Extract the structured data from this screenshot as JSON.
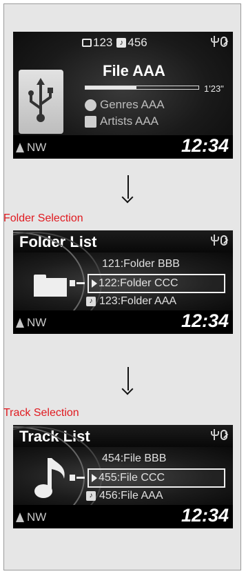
{
  "screen1": {
    "folder_count": "123",
    "track_count": "456",
    "file_title": "File AAA",
    "elapsed": "1'23\"",
    "progress": 0.45,
    "genre": "Genres AAA",
    "artist": "Artists AAA",
    "heading": "NW",
    "clock": "12:34"
  },
  "folder_section": {
    "label": "Folder Selection",
    "title": "Folder List",
    "items": [
      "121:Folder BBB",
      "122:Folder CCC",
      "123:Folder AAA"
    ],
    "heading": "NW",
    "clock": "12:34"
  },
  "track_section": {
    "label": "Track Selection",
    "title": "Track List",
    "items": [
      "454:File BBB",
      "455:File CCC",
      "456:File AAA"
    ],
    "heading": "NW",
    "clock": "12:34"
  },
  "icons": {
    "folder_counter": "folder-icon",
    "track_counter": "music-note-icon",
    "usb": "usb-icon",
    "bluetooth": "bluetooth-icon",
    "compass": "compass-arrow-icon",
    "genre": "genre-icon",
    "artist": "artist-icon"
  },
  "colors": {
    "section_label": "#e0191f",
    "screen_bg": "#0e0e0e",
    "panel_bg": "#e6e6e6"
  }
}
